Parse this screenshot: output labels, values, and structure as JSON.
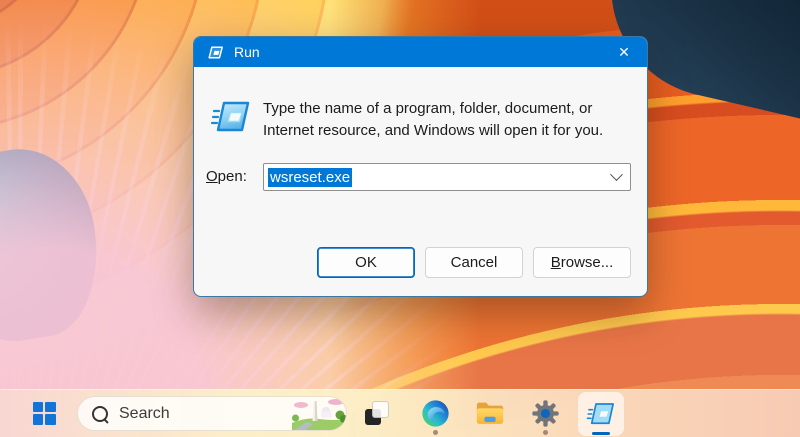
{
  "window": {
    "title": "Run",
    "close_glyph": "✕",
    "message": "Type the name of a program, folder, document, or Internet resource, and Windows will open it for you.",
    "open_label": {
      "accesskey": "O",
      "rest": "pen:"
    },
    "input": {
      "value": "wsreset.exe"
    },
    "buttons": {
      "ok": "OK",
      "cancel": "Cancel",
      "browse": {
        "accesskey": "B",
        "rest": "rowse..."
      }
    }
  },
  "taskbar": {
    "search_label": "Search",
    "items": [
      "start",
      "search",
      "task-view",
      "edge",
      "file-explorer",
      "settings",
      "run"
    ],
    "active_item": "run"
  },
  "colors": {
    "titlebar_bg": "#0078d7",
    "titlebar_text": "#ffffff",
    "selection_bg": "#0078d7",
    "selection_text": "#ffffff",
    "default_button_border": "#0067c0",
    "run_indicator": "#0067c0",
    "start_logo_blue": "#1374d8"
  }
}
